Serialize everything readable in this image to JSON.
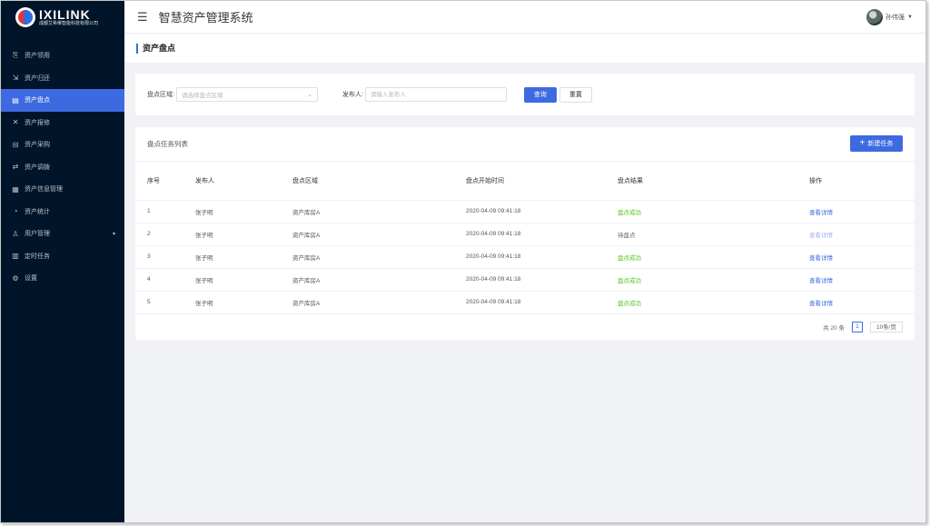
{
  "logo": {
    "title": "IXILINK",
    "subtitle": "成都艾希维智能科技有限公司"
  },
  "sidebar": {
    "items": [
      {
        "label": "资产领用",
        "icon": "asset-receive-icon"
      },
      {
        "label": "资产归还",
        "icon": "asset-return-icon"
      },
      {
        "label": "资产盘点",
        "icon": "asset-inventory-icon",
        "active": true
      },
      {
        "label": "资产报修",
        "icon": "asset-repair-icon"
      },
      {
        "label": "资产采购",
        "icon": "asset-purchase-icon"
      },
      {
        "label": "资产调拨",
        "icon": "asset-transfer-icon"
      },
      {
        "label": "资产信息管理",
        "icon": "asset-info-icon"
      },
      {
        "label": "资产统计",
        "icon": "asset-stats-icon"
      },
      {
        "label": "用户管理",
        "icon": "user-manage-icon",
        "has_children": true
      },
      {
        "label": "定时任务",
        "icon": "scheduled-task-icon"
      },
      {
        "label": "设置",
        "icon": "settings-icon"
      }
    ]
  },
  "header": {
    "menu_icon": "hamburger-icon",
    "app_title": "智慧资产管理系统",
    "user_name": "孙伟强"
  },
  "page": {
    "title": "资产盘点"
  },
  "filter": {
    "area_label": "盘点区域:",
    "area_placeholder": "请选择盘点区域",
    "creator_label": "发布人:",
    "creator_placeholder": "请输入发布人",
    "query_label": "查询",
    "reset_label": "重置"
  },
  "list": {
    "title": "盘点任务列表",
    "new_button": "新建任务",
    "columns": [
      "序号",
      "发布人",
      "盘点区域",
      "盘点开始时间",
      "盘点结果",
      "操作"
    ],
    "rows": [
      {
        "no": "1",
        "creator": "张子明",
        "area": "资产库房A",
        "start": "2020-04-09 09:41:18",
        "result": "盘点成功",
        "status": "ok",
        "op": "查看详情"
      },
      {
        "no": "2",
        "creator": "张子明",
        "area": "资产库房A",
        "start": "2020-04-09 09:41:18",
        "result": "待盘点",
        "status": "pending",
        "op": "查看详情"
      },
      {
        "no": "3",
        "creator": "张子明",
        "area": "资产库房A",
        "start": "2020-04-09 09:41:18",
        "result": "盘点成功",
        "status": "ok",
        "op": "查看详情"
      },
      {
        "no": "4",
        "creator": "张子明",
        "area": "资产库房A",
        "start": "2020-04-09 09:41:18",
        "result": "盘点成功",
        "status": "ok",
        "op": "查看详情"
      },
      {
        "no": "5",
        "creator": "张子明",
        "area": "资产库房A",
        "start": "2020-04-09 09:41:18",
        "result": "盘点成功",
        "status": "ok",
        "op": "查看详情"
      }
    ]
  },
  "pagination": {
    "total": "共 20 条",
    "current": "1",
    "page_size": "10条/页"
  },
  "colors": {
    "sidebar_bg": "#001529",
    "accent": "#3e6ae1",
    "success": "#52c41a"
  }
}
